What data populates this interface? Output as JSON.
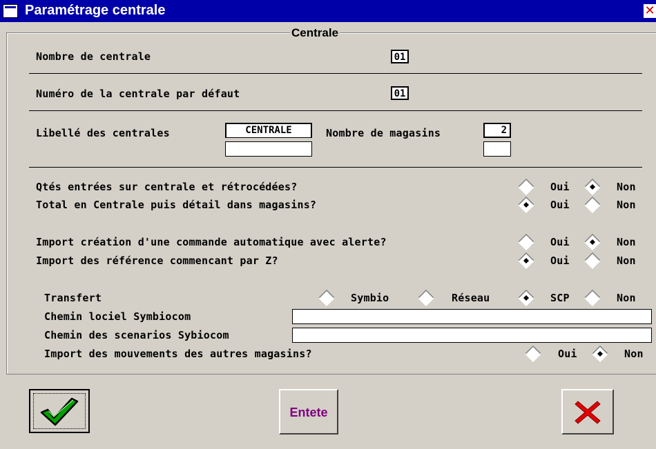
{
  "window": {
    "title": "Paramétrage centrale"
  },
  "group": {
    "title": "Centrale"
  },
  "nombre_centrale": {
    "label": "Nombre de centrale",
    "value": "01"
  },
  "numero_defaut": {
    "label": "Numéro de la centrale par défaut",
    "value": "01"
  },
  "libelle": {
    "label": "Libellé des centrales",
    "value1": "CENTRALE",
    "value2": "",
    "magasins_label": "Nombre de magasins",
    "magasins_value1": "2",
    "magasins_value2": ""
  },
  "options": {
    "oui": "Oui",
    "non": "Non",
    "qtes": {
      "label": "Qtés entrées sur centrale et rétrocédées?",
      "selected": "Non"
    },
    "total": {
      "label": "Total en Centrale puis détail dans magasins?",
      "selected": "Oui"
    },
    "import_commande": {
      "label": "Import création d'une commande automatique avec alerte?",
      "selected": "Non"
    },
    "import_z": {
      "label": "Import des référence commencant par Z?",
      "selected": "Oui"
    }
  },
  "transfert": {
    "label": "Transfert",
    "choices": [
      "Symbio",
      "Réseau",
      "SCP",
      "Non"
    ],
    "selected": "SCP"
  },
  "chemin_logiciel": {
    "label": "Chemin lociel Symbiocom",
    "value": ""
  },
  "chemin_scenarios": {
    "label": "Chemin des scenarios Sybiocom",
    "value": ""
  },
  "import_mouvements": {
    "label": "Import des mouvements des autres magasins?",
    "selected": "Non"
  },
  "buttons": {
    "entete": "Entete"
  }
}
